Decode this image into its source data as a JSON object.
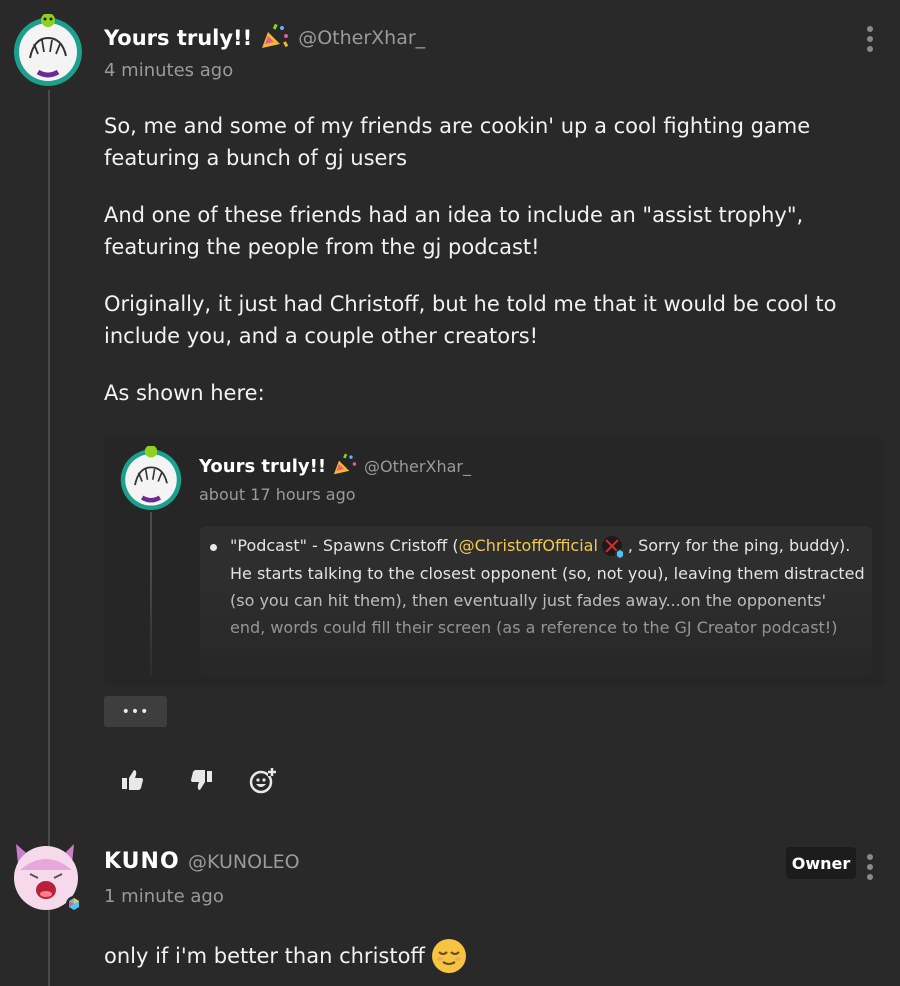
{
  "comment1": {
    "author_name": "Yours truly!!",
    "handle": "@OtherXhar_",
    "time": "4 minutes ago",
    "paragraphs": [
      "So, me and some of my friends are cookin' up a cool fighting game featuring a bunch of gj users",
      "And one of these friends had an idea to include an \"assist trophy\", featuring the people from the gj podcast!",
      "Originally, it just had Christoff, but he told me that it would be cool to include you, and a couple other creators!",
      "As shown here:"
    ],
    "embed": {
      "author_name": "Yours truly!!",
      "handle": "@OtherXhar_",
      "time": "about 17 hours ago",
      "text_before": "\"Podcast\" - Spawns Cristoff (",
      "mention": "@ChristoffOfficial",
      "text_after": ", Sorry for the ping, buddy). He starts talking to the closest opponent (so, not you), leaving them distracted (so you can hit them), then eventually just fades away...on the opponents' end, words could fill their screen (as a reference to the GJ Creator podcast!)"
    },
    "more_label": "•••",
    "actions": [
      "thumbs-up-icon",
      "thumbs-down-icon",
      "add-reaction-icon"
    ]
  },
  "comment2": {
    "author_name": "KUNO",
    "handle": "@KUNOLEO",
    "time": "1 minute ago",
    "badge": "Owner",
    "text": "only if i'm better than christoff"
  },
  "colors": {
    "background": "#292929",
    "mention": "#f2c94c",
    "muted": "#9a9a9a"
  }
}
